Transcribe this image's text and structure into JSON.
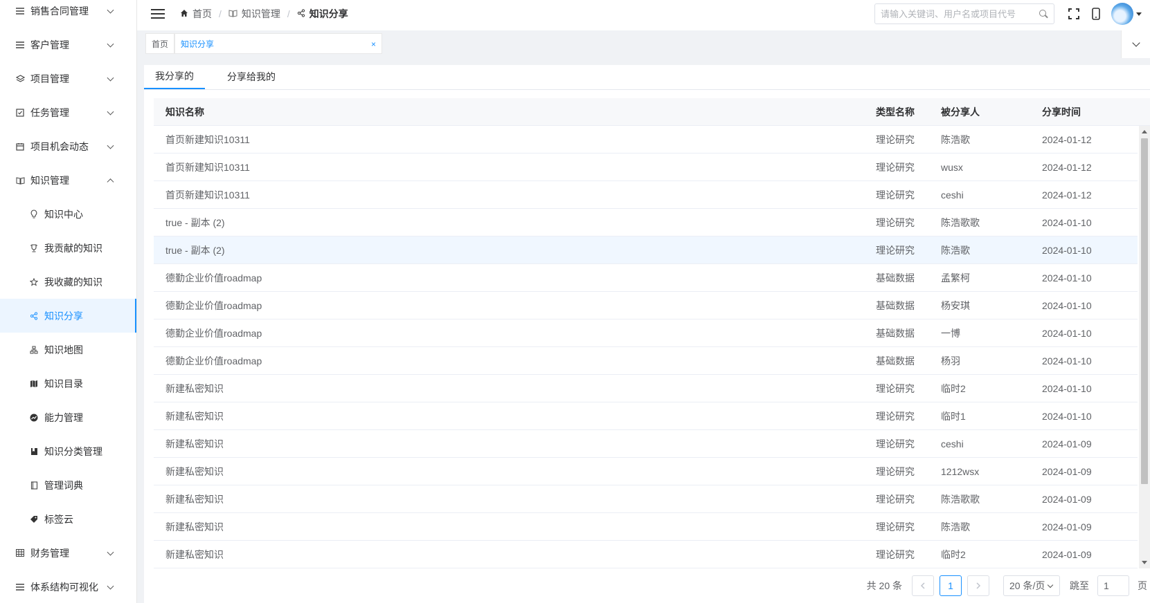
{
  "sidebar": {
    "items": [
      {
        "label": "销售合同管理",
        "icon": "list-icon",
        "name": "sidebar-item-sales-contract"
      },
      {
        "label": "客户管理",
        "icon": "list-icon",
        "name": "sidebar-item-customer"
      },
      {
        "label": "项目管理",
        "icon": "layers-icon",
        "name": "sidebar-item-project"
      },
      {
        "label": "任务管理",
        "icon": "checkbox-icon",
        "name": "sidebar-item-task"
      },
      {
        "label": "项目机会动态",
        "icon": "calendar-icon",
        "name": "sidebar-item-opportunity"
      },
      {
        "label": "知识管理",
        "icon": "book-icon",
        "name": "sidebar-item-knowledge",
        "expanded": true
      }
    ],
    "submenu": [
      {
        "label": "知识中心",
        "icon": "lightbulb-icon",
        "name": "sidebar-sub-knowledge-center"
      },
      {
        "label": "我贡献的知识",
        "icon": "trophy-icon",
        "name": "sidebar-sub-my-contributions"
      },
      {
        "label": "我收藏的知识",
        "icon": "star-icon",
        "name": "sidebar-sub-my-favorites"
      },
      {
        "label": "知识分享",
        "icon": "share-icon",
        "name": "sidebar-sub-knowledge-share",
        "active": true
      },
      {
        "label": "知识地图",
        "icon": "sitemap-icon",
        "name": "sidebar-sub-knowledge-map"
      },
      {
        "label": "知识目录",
        "icon": "map-icon",
        "name": "sidebar-sub-knowledge-catalog"
      },
      {
        "label": "能力管理",
        "icon": "chart-icon",
        "name": "sidebar-sub-capability"
      },
      {
        "label": "知识分类管理",
        "icon": "bookmark-book-icon",
        "name": "sidebar-sub-category"
      },
      {
        "label": "管理词典",
        "icon": "dictionary-icon",
        "name": "sidebar-sub-dictionary"
      },
      {
        "label": "标签云",
        "icon": "tag-icon",
        "name": "sidebar-sub-tag-cloud"
      }
    ],
    "bottom_items": [
      {
        "label": "财务管理",
        "icon": "table-icon",
        "name": "sidebar-item-finance"
      },
      {
        "label": "体系结构可视化",
        "icon": "list-icon",
        "name": "sidebar-item-architecture"
      }
    ]
  },
  "header": {
    "breadcrumb": [
      {
        "label": "首页",
        "icon": "home-icon"
      },
      {
        "label": "知识管理",
        "icon": "book-icon"
      },
      {
        "label": "知识分享",
        "icon": "share-icon"
      }
    ],
    "search_placeholder": "请输入关键词、用户名或项目代号"
  },
  "tags": {
    "home": "首页",
    "current": "知识分享",
    "close": "×"
  },
  "tabs": [
    "我分享的",
    "分享给我的"
  ],
  "table": {
    "headers": [
      "知识名称",
      "类型名称",
      "被分享人",
      "分享时间"
    ],
    "rows": [
      [
        "首页新建知识10311",
        "理论研究",
        "陈浩歌",
        "2024-01-12"
      ],
      [
        "首页新建知识10311",
        "理论研究",
        "wusx",
        "2024-01-12"
      ],
      [
        "首页新建知识10311",
        "理论研究",
        "ceshi",
        "2024-01-12"
      ],
      [
        "true - 副本 (2)",
        "理论研究",
        "陈浩歌歌",
        "2024-01-10"
      ],
      [
        "true - 副本 (2)",
        "理论研究",
        "陈浩歌",
        "2024-01-10"
      ],
      [
        "德勤企业价值roadmap",
        "基础数据",
        "孟繁柯",
        "2024-01-10"
      ],
      [
        "德勤企业价值roadmap",
        "基础数据",
        "杨安琪",
        "2024-01-10"
      ],
      [
        "德勤企业价值roadmap",
        "基础数据",
        "一博",
        "2024-01-10"
      ],
      [
        "德勤企业价值roadmap",
        "基础数据",
        "杨羽",
        "2024-01-10"
      ],
      [
        "新建私密知识",
        "理论研究",
        "临时2",
        "2024-01-10"
      ],
      [
        "新建私密知识",
        "理论研究",
        "临时1",
        "2024-01-10"
      ],
      [
        "新建私密知识",
        "理论研究",
        "ceshi",
        "2024-01-09"
      ],
      [
        "新建私密知识",
        "理论研究",
        "1212wsx",
        "2024-01-09"
      ],
      [
        "新建私密知识",
        "理论研究",
        "陈浩歌歌",
        "2024-01-09"
      ],
      [
        "新建私密知识",
        "理论研究",
        "陈浩歌",
        "2024-01-09"
      ],
      [
        "新建私密知识",
        "理论研究",
        "临时2",
        "2024-01-09"
      ]
    ]
  },
  "pagination": {
    "total": "共 20 条",
    "current_page": "1",
    "page_size": "20 条/页",
    "jump_label": "跳至",
    "jump_value": "1",
    "page_suffix": "页"
  },
  "colors": {
    "accent": "#1890ff",
    "row_hover": "#f0f7ff"
  }
}
